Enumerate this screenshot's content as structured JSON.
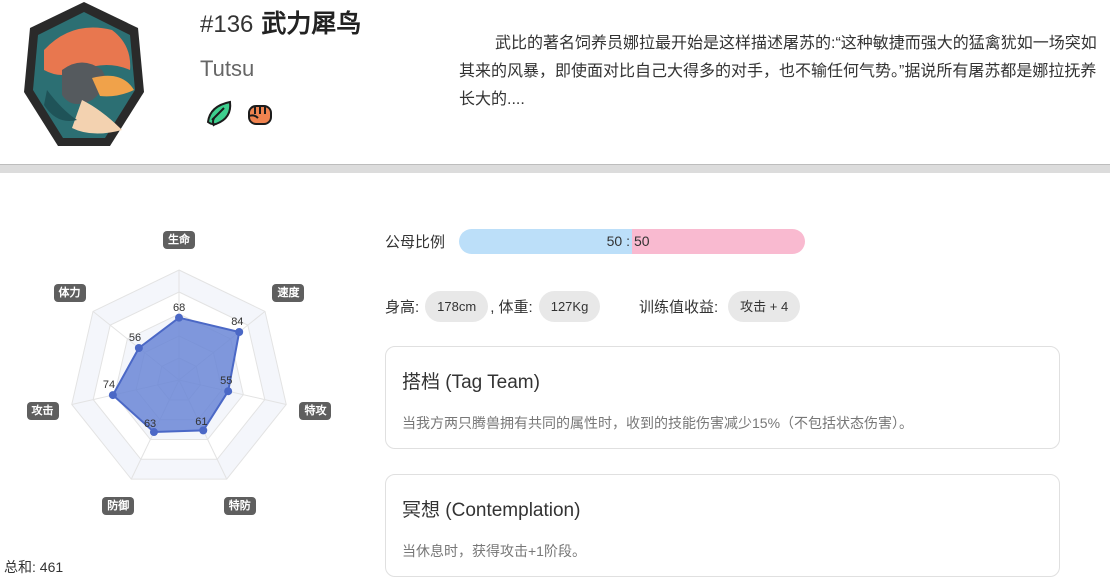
{
  "pokemon": {
    "number": "#136",
    "name": "武力犀鸟",
    "english_name": "Tutsu",
    "description": "武比的著名饲养员娜拉最开始是这样描述屠苏的:“这种敏捷而强大的猛禽犹如一场突如其来的风暴，即使面对比自己大得多的对手，也不输任何气势。”据说所有屠苏都是娜拉抚养长大的....",
    "types": [
      {
        "name": "grass-type-icon",
        "color": "#3ecf8e"
      },
      {
        "name": "fighting-type-icon",
        "color": "#f0834f"
      }
    ],
    "avatar_icon": "bird-avatar-icon"
  },
  "stats": {
    "labels": {
      "hp": "生命",
      "speed": "速度",
      "sp_atk": "特攻",
      "sp_def": "特防",
      "defense": "防御",
      "attack": "攻击",
      "stamina": "体力"
    },
    "values": {
      "hp": 68,
      "speed": 84,
      "sp_atk": 55,
      "sp_def": 61,
      "defense": 63,
      "attack": 74,
      "stamina": 56
    },
    "value_texts": {
      "hp": "68",
      "speed": "84",
      "sp_atk": "55",
      "sp_def": "61",
      "defense": "63",
      "attack": "74",
      "stamina": "56"
    },
    "total": "总和: 461",
    "fill_color": "#6a86d6",
    "line_color": "#4b68c6"
  },
  "gender": {
    "label": "公母比例",
    "male_text": "50",
    "separator": ":",
    "female_text": "50",
    "male_ratio": 0.5,
    "male_color": "#bcdff9",
    "female_color": "#f9bad0"
  },
  "body": {
    "height_label": "身高:",
    "height_value": "178cm",
    "weight_label": ", 体重:",
    "weight_value": "127Kg",
    "ev_label": "训练值收益:",
    "ev_value": "攻击 + 4"
  },
  "abilities": [
    {
      "title": "搭档 (Tag Team)",
      "description": "当我方两只腾兽拥有共同的属性时，收到的技能伤害减少15%（不包括状态伤害）。"
    },
    {
      "title": "冥想 (Contemplation)",
      "description": "当休息时，获得攻击+1阶段。"
    }
  ]
}
